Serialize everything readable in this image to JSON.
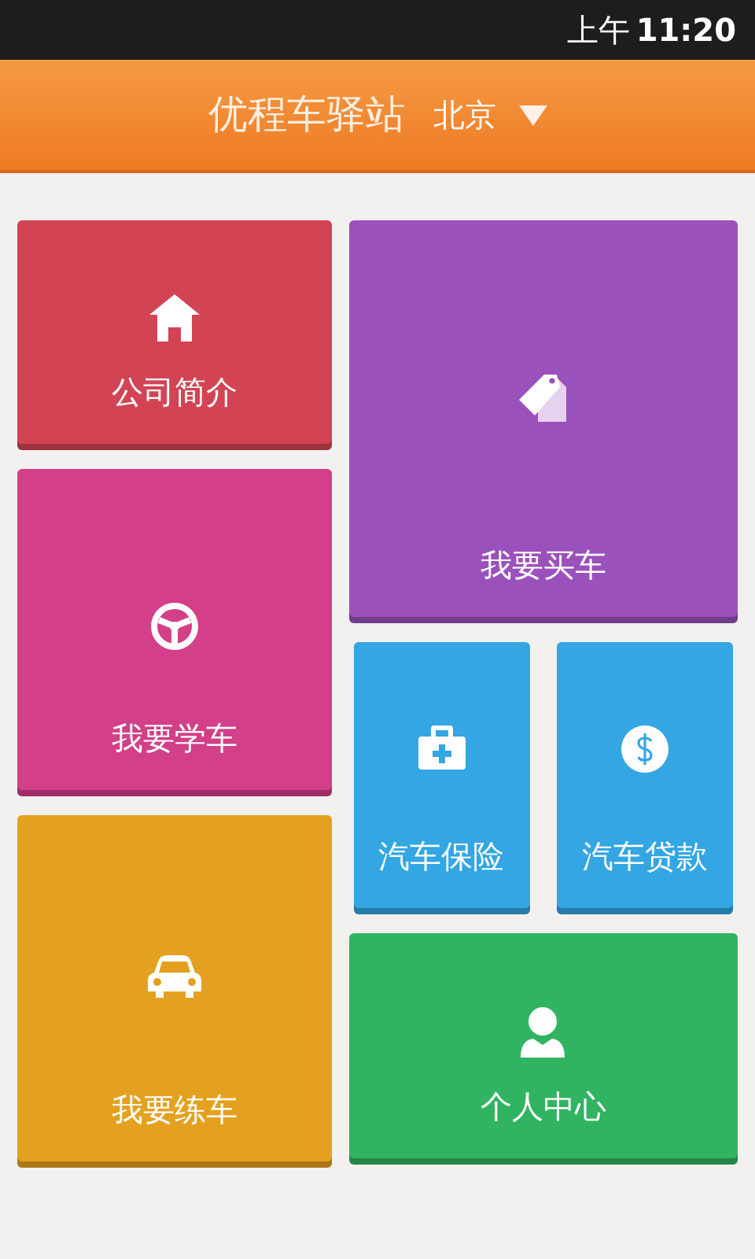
{
  "status_bar": {
    "time_prefix": "上午",
    "time": "11:20"
  },
  "header": {
    "title": "优程车驿站",
    "city": "北京"
  },
  "left_tiles": [
    {
      "label": "公司简介",
      "kind": "home",
      "color": "#d24454"
    },
    {
      "label": "我要学车",
      "kind": "wheel",
      "color": "#d33f88"
    },
    {
      "label": "我要练车",
      "kind": "car",
      "color": "#e4a11f"
    }
  ],
  "right_tiles": [
    {
      "label": "我要买车",
      "kind": "tag",
      "color": "#9b51bb"
    },
    {
      "label": "汽车保险",
      "kind": "kit",
      "color": "#33a6e3"
    },
    {
      "label": "汽车贷款",
      "kind": "money",
      "color": "#33a6e3"
    },
    {
      "label": "个人中心",
      "kind": "person",
      "color": "#31b461"
    }
  ]
}
